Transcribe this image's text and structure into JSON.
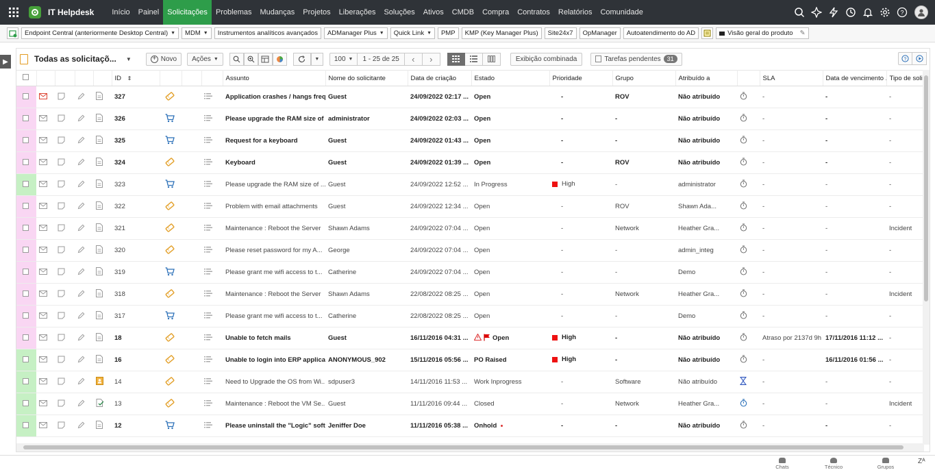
{
  "app": {
    "title": "IT Helpdesk"
  },
  "nav": {
    "items": [
      {
        "label": "Início",
        "active": false
      },
      {
        "label": "Painel",
        "active": false
      },
      {
        "label": "Solicitações",
        "active": true
      },
      {
        "label": "Problemas",
        "active": false
      },
      {
        "label": "Mudanças",
        "active": false
      },
      {
        "label": "Projetos",
        "active": false
      },
      {
        "label": "Liberações",
        "active": false
      },
      {
        "label": "Soluções",
        "active": false
      },
      {
        "label": "Ativos",
        "active": false
      },
      {
        "label": "CMDB",
        "active": false
      },
      {
        "label": "Compra",
        "active": false
      },
      {
        "label": "Contratos",
        "active": false
      },
      {
        "label": "Relatórios",
        "active": false
      },
      {
        "label": "Comunidade",
        "active": false
      }
    ],
    "right_icons": [
      "search-icon",
      "quick-create-icon",
      "lightning-icon",
      "history-icon",
      "bell-icon",
      "gear-icon",
      "help-icon",
      "user-avatar-icon"
    ]
  },
  "quicklinks": {
    "items": [
      {
        "label": "Endpoint Central (anteriormente Desktop Central)",
        "dropdown": true
      },
      {
        "label": "MDM",
        "dropdown": true
      },
      {
        "label": "Instrumentos analíticos avançados",
        "dropdown": false
      },
      {
        "label": "ADManager Plus",
        "dropdown": true
      },
      {
        "label": "Quick Link",
        "dropdown": true
      },
      {
        "label": "PMP",
        "dropdown": false
      },
      {
        "label": "KMP (Key Manager Plus)",
        "dropdown": false
      },
      {
        "label": "Site24x7",
        "dropdown": false
      },
      {
        "label": "OpManager",
        "dropdown": false
      },
      {
        "label": "Autoatendimento do AD",
        "dropdown": false
      }
    ],
    "product_overview": "Visão geral do produto"
  },
  "toolbar": {
    "view_title": "Todas as solicitaçõ...",
    "new_label": "Novo",
    "actions_label": "Ações",
    "per_page": "100",
    "range": "1 - 25 de 25",
    "combined_view": "Exibição combinada",
    "pending_tasks": "Tarefas pendentes",
    "pending_count": "31"
  },
  "table": {
    "columns": [
      "ID",
      "Assunto",
      "Nome do solicitante",
      "Data de criação",
      "Estado",
      "Prioridade",
      "Grupo",
      "Atribuído a",
      "SLA",
      "Data de vencimento ...",
      "Tipo de solicitação"
    ],
    "rows": [
      {
        "status_color": "#f9d6f3",
        "unread": true,
        "mail_red": true,
        "doc": "doc",
        "type": "incident",
        "id": "327",
        "subject": "Application crashes / hangs freq...",
        "requester": "Guest",
        "created": "24/09/2022 02:17 ...",
        "state": "Open",
        "state_flag": false,
        "priority": "-",
        "priority_high": false,
        "group": "ROV",
        "assigned": "Não atribuído",
        "sla_icon": "timer",
        "sla": "-",
        "due": "-",
        "req_type": "-"
      },
      {
        "status_color": "#f9d6f3",
        "unread": true,
        "mail_red": false,
        "doc": "doc",
        "type": "service",
        "id": "326",
        "subject": "Please upgrade the RAM size of ...",
        "requester": "administrator",
        "created": "24/09/2022 02:03 ...",
        "state": "Open",
        "state_flag": false,
        "priority": "-",
        "priority_high": false,
        "group": "-",
        "assigned": "Não atribuído",
        "sla_icon": "timer",
        "sla": "-",
        "due": "-",
        "req_type": "-"
      },
      {
        "status_color": "#f9d6f3",
        "unread": true,
        "mail_red": false,
        "doc": "doc",
        "type": "service",
        "id": "325",
        "subject": "Request for a keyboard",
        "requester": "Guest",
        "created": "24/09/2022 01:43 ...",
        "state": "Open",
        "state_flag": false,
        "priority": "-",
        "priority_high": false,
        "group": "-",
        "assigned": "Não atribuído",
        "sla_icon": "timer",
        "sla": "-",
        "due": "-",
        "req_type": "-"
      },
      {
        "status_color": "#f9d6f3",
        "unread": true,
        "mail_red": false,
        "doc": "doc",
        "type": "incident",
        "id": "324",
        "subject": "Keyboard",
        "requester": "Guest",
        "created": "24/09/2022 01:39 ...",
        "state": "Open",
        "state_flag": false,
        "priority": "-",
        "priority_high": false,
        "group": "ROV",
        "assigned": "Não atribuído",
        "sla_icon": "timer",
        "sla": "-",
        "due": "-",
        "req_type": "-"
      },
      {
        "status_color": "#c6f0c4",
        "unread": false,
        "mail_red": false,
        "doc": "doc",
        "type": "service",
        "id": "323",
        "subject": "Please upgrade the RAM size of ...",
        "requester": "Guest",
        "created": "24/09/2022 12:52 ...",
        "state": "In Progress",
        "state_flag": false,
        "priority": "High",
        "priority_high": true,
        "group": "-",
        "assigned": "administrator",
        "sla_icon": "timer",
        "sla": "-",
        "due": "-",
        "req_type": "-"
      },
      {
        "status_color": "#f9d6f3",
        "unread": false,
        "mail_red": false,
        "doc": "doc",
        "type": "incident",
        "id": "322",
        "subject": "Problem with email attachments",
        "requester": "Guest",
        "created": "24/09/2022 12:34 ...",
        "state": "Open",
        "state_flag": false,
        "priority": "-",
        "priority_high": false,
        "group": "ROV",
        "assigned": "Shawn Ada...",
        "sla_icon": "timer",
        "sla": "-",
        "due": "-",
        "req_type": "-"
      },
      {
        "status_color": "#f9d6f3",
        "unread": false,
        "mail_red": false,
        "doc": "doc",
        "type": "incident",
        "id": "321",
        "subject": "Maintenance : Reboot the Server",
        "requester": "Shawn Adams",
        "created": "24/09/2022 07:04 ...",
        "state": "Open",
        "state_flag": false,
        "priority": "-",
        "priority_high": false,
        "group": "Network",
        "assigned": "Heather Gra...",
        "sla_icon": "timer",
        "sla": "-",
        "due": "-",
        "req_type": "Incident"
      },
      {
        "status_color": "#f9d6f3",
        "unread": false,
        "mail_red": false,
        "doc": "doc",
        "type": "incident",
        "id": "320",
        "subject": "Please reset password for my A...",
        "requester": "George",
        "created": "24/09/2022 07:04 ...",
        "state": "Open",
        "state_flag": false,
        "priority": "-",
        "priority_high": false,
        "group": "-",
        "assigned": "admin_integ",
        "sla_icon": "timer",
        "sla": "-",
        "due": "-",
        "req_type": "-"
      },
      {
        "status_color": "#f9d6f3",
        "unread": false,
        "mail_red": false,
        "doc": "doc",
        "type": "service",
        "id": "319",
        "subject": "Please grant me wifi access to t...",
        "requester": "Catherine",
        "created": "24/09/2022 07:04 ...",
        "state": "Open",
        "state_flag": false,
        "priority": "-",
        "priority_high": false,
        "group": "-",
        "assigned": "Demo",
        "sla_icon": "timer",
        "sla": "-",
        "due": "-",
        "req_type": "-"
      },
      {
        "status_color": "#f9d6f3",
        "unread": false,
        "mail_red": false,
        "doc": "doc",
        "type": "incident",
        "id": "318",
        "subject": "Maintenance : Reboot the Server",
        "requester": "Shawn Adams",
        "created": "22/08/2022 08:25 ...",
        "state": "Open",
        "state_flag": false,
        "priority": "-",
        "priority_high": false,
        "group": "Network",
        "assigned": "Heather Gra...",
        "sla_icon": "timer",
        "sla": "-",
        "due": "-",
        "req_type": "Incident"
      },
      {
        "status_color": "#f9d6f3",
        "unread": false,
        "mail_red": false,
        "doc": "doc",
        "type": "service",
        "id": "317",
        "subject": "Please grant me wifi access to t...",
        "requester": "Catherine",
        "created": "22/08/2022 08:25 ...",
        "state": "Open",
        "state_flag": false,
        "priority": "-",
        "priority_high": false,
        "group": "-",
        "assigned": "Demo",
        "sla_icon": "timer",
        "sla": "-",
        "due": "-",
        "req_type": "-"
      },
      {
        "status_color": "#f9d6f3",
        "unread": true,
        "mail_red": false,
        "doc": "doc",
        "type": "incident",
        "id": "18",
        "subject": "Unable to fetch mails",
        "requester": "Guest",
        "created": "16/11/2016 04:31 ...",
        "state": "Open",
        "state_flag": true,
        "priority": "High",
        "priority_high": true,
        "group": "-",
        "assigned": "Não atribuído",
        "sla_icon": "timer",
        "sla": "Atraso por 2137d 9h",
        "due": "17/11/2016 11:12 ...",
        "req_type": "-"
      },
      {
        "status_color": "#c6f0c4",
        "unread": true,
        "mail_red": false,
        "doc": "doc",
        "type": "incident",
        "id": "16",
        "subject": "Unable to login into ERP applica...",
        "requester": "ANONYMOUS_902",
        "created": "15/11/2016 05:56 ...",
        "state": "PO Raised",
        "state_flag": false,
        "priority": "High",
        "priority_high": true,
        "group": "-",
        "assigned": "Não atribuído",
        "sla_icon": "timer",
        "sla": "-",
        "due": "16/11/2016 01:56 ...",
        "req_type": "-"
      },
      {
        "status_color": "#c6f0c4",
        "unread": false,
        "mail_red": false,
        "doc": "approval",
        "type": "incident",
        "id": "14",
        "subject": "Need to Upgrade the OS from Wi...",
        "requester": "sdpuser3",
        "created": "14/11/2016 11:53 ...",
        "state": "Work Inprogress",
        "state_flag": false,
        "priority": "-",
        "priority_high": false,
        "group": "Software",
        "assigned": "Não atribuído",
        "sla_icon": "hourglass",
        "sla": "-",
        "due": "-",
        "req_type": "-"
      },
      {
        "status_color": "#c6f0c4",
        "unread": false,
        "mail_red": false,
        "doc": "checked",
        "type": "incident",
        "id": "13",
        "subject": "Maintenance : Reboot the VM Se...",
        "requester": "Guest",
        "created": "11/11/2016 09:44 ...",
        "state": "Closed",
        "state_flag": false,
        "priority": "-",
        "priority_high": false,
        "group": "Network",
        "assigned": "Heather Gra...",
        "sla_icon": "timer-blue",
        "sla": "-",
        "due": "-",
        "req_type": "Incident"
      },
      {
        "status_color": "#c6f0c4",
        "unread": true,
        "mail_red": false,
        "doc": "doc",
        "type": "service",
        "id": "12",
        "subject": "Please uninstall the \"Logic\" soft...",
        "requester": "Jeniffer Doe",
        "created": "11/11/2016 05:38 ...",
        "state": "Onhold",
        "state_flag": false,
        "priority": "-",
        "priority_high": false,
        "group": "-",
        "assigned": "Não atribuído",
        "sla_icon": "timer",
        "sla": "-",
        "due": "-",
        "req_type": "-"
      }
    ]
  },
  "bottombar": {
    "items": [
      {
        "label": "Chats"
      },
      {
        "label": "Técnico"
      },
      {
        "label": "Grupos"
      }
    ]
  }
}
